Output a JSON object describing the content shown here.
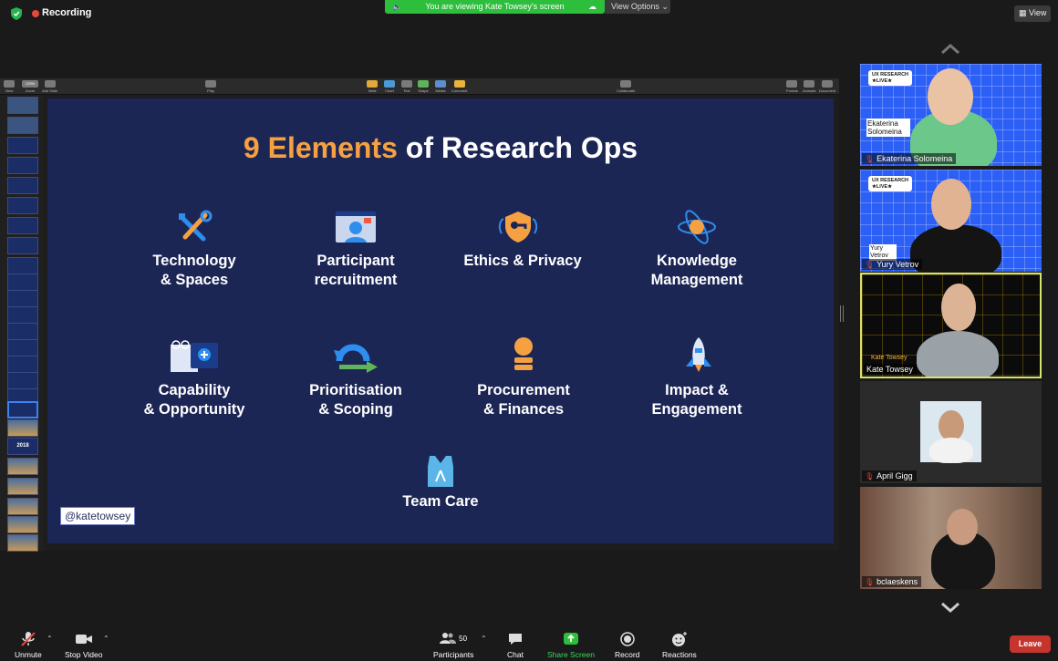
{
  "recording": {
    "label": "Recording"
  },
  "banner": {
    "text": "You are viewing Kate Towsey's screen",
    "view_options": "View Options"
  },
  "view_button": {
    "label": "View"
  },
  "keynote_toolbar": {
    "items": [
      "View",
      "Zoom",
      "Add Slide",
      "Play",
      "Table",
      "Chart",
      "Text",
      "Shape",
      "Media",
      "Comment",
      "Collaborate",
      "Format",
      "Animate",
      "Document"
    ],
    "zoom_value": "125%"
  },
  "sidebar": {
    "year_thumb": "2018"
  },
  "slide": {
    "title_highlight": "9 Elements",
    "title_rest": " of Research Ops",
    "elements": [
      {
        "line1": "Technology",
        "line2": "& Spaces",
        "icon": "tools-icon"
      },
      {
        "line1": "Participant",
        "line2": "recruitment",
        "icon": "participant-icon"
      },
      {
        "line1": "Ethics & Privacy",
        "line2": "",
        "icon": "shield-key-icon"
      },
      {
        "line1": "Knowledge",
        "line2": "Management",
        "icon": "atom-icon"
      },
      {
        "line1": "Capability",
        "line2": "& Opportunity",
        "icon": "book-glasses-icon"
      },
      {
        "line1": "Prioritisation",
        "line2": "& Scoping",
        "icon": "arrow-cycle-icon"
      },
      {
        "line1": "Procurement",
        "line2": "& Finances",
        "icon": "coins-icon"
      },
      {
        "line1": "Impact &",
        "line2": "Engagement",
        "icon": "rocket-icon"
      },
      {
        "line1": "Team Care",
        "line2": "",
        "icon": "vest-icon"
      }
    ],
    "handle": "@katetowsey"
  },
  "participants": [
    {
      "name": "Ekaterina Solomeina",
      "overlay_name": "Ekaterina Solomeina",
      "muted": true
    },
    {
      "name": "Yury Vetrov",
      "overlay_name": "Yury Vetrov",
      "muted": true
    },
    {
      "name": "Kate Towsey",
      "overlay_name": "Kate Towsey",
      "muted": false,
      "speaking": true
    },
    {
      "name": "April Gigg",
      "muted": true
    },
    {
      "name": "bclaeskens",
      "muted": true
    }
  ],
  "uxr_logo": {
    "line1": "UX RESEARCH",
    "line2": "★LIVE★"
  },
  "bottom_bar": {
    "unmute": "Unmute",
    "stop_video": "Stop Video",
    "participants": "Participants",
    "participants_count": "50",
    "chat": "Chat",
    "share_screen": "Share Screen",
    "record": "Record",
    "reactions": "Reactions",
    "leave": "Leave"
  },
  "colors": {
    "accent_orange": "#f5a142",
    "share_green": "#2dbf3c",
    "leave_red": "#c6352d",
    "slide_bg": "#1c2655",
    "speaker_border": "#d6e36f"
  }
}
